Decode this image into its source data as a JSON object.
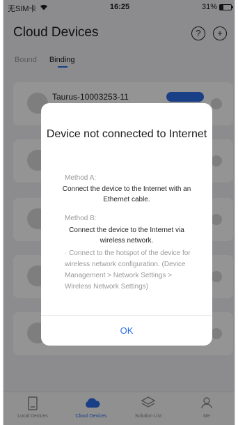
{
  "status_bar": {
    "carrier": "无SIM卡",
    "time": "16:25",
    "battery": "31%",
    "battery_level": 0.31
  },
  "header": {
    "title": "Cloud Devices",
    "help_icon": "question-circle-icon",
    "add_icon": "plus-circle-icon"
  },
  "tabs": [
    {
      "label": "Bound",
      "active": false
    },
    {
      "label": "Binding",
      "active": true
    }
  ],
  "cards": [
    {
      "title": "Taurus-10003253-11"
    }
  ],
  "dialog": {
    "title": "Device not connected to Internet",
    "method_a_label": "Method A:",
    "method_a_text": "Connect the device to the Internet with an Ethernet cable.",
    "method_b_label": "Method B:",
    "method_b_text": "Connect the device to the Internet via wireless network.",
    "method_b_note": "· Connect to the hotspot of the device for wireless network configuration. (Device Management > Network Settings > Wireless Network Settings)",
    "ok_label": "OK"
  },
  "bottom_nav": [
    {
      "label": "Local Devices",
      "icon": "local-devices-icon",
      "active": false
    },
    {
      "label": "Cloud Devices",
      "icon": "cloud-icon",
      "active": true
    },
    {
      "label": "Solution List",
      "icon": "layers-icon",
      "active": false
    },
    {
      "label": "Me",
      "icon": "person-icon",
      "active": false
    }
  ],
  "colors": {
    "accent": "#2b6de8",
    "overlay": "rgba(0,0,0,0.42)"
  }
}
